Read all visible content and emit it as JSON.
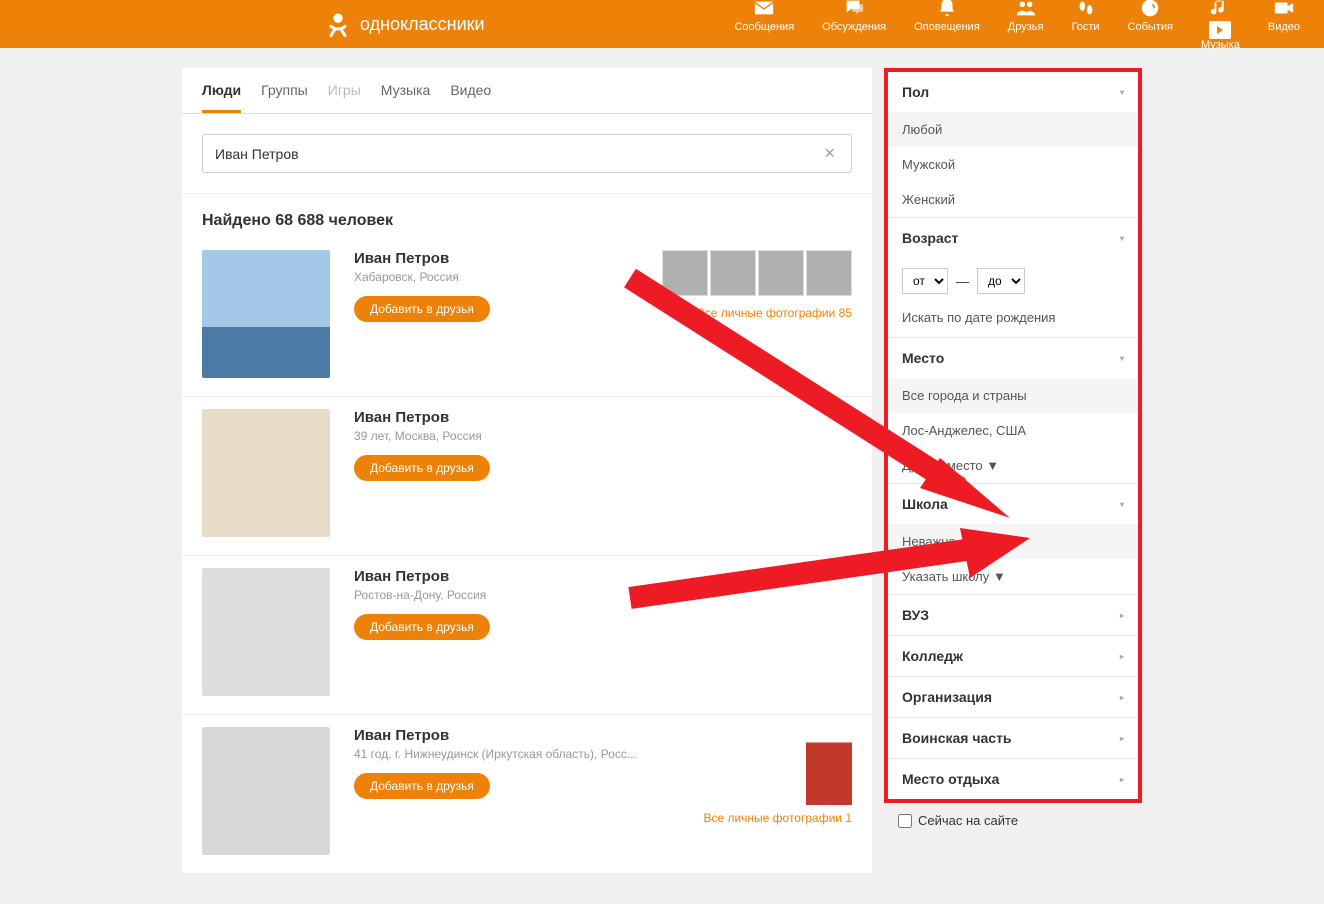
{
  "brand": "одноклассники",
  "nav": {
    "messages": "Сообщения",
    "discussions": "Обсуждения",
    "notifications": "Оповещения",
    "friends": "Друзья",
    "guests": "Гости",
    "events": "События",
    "music": "Музыка",
    "video": "Видео"
  },
  "tabs": {
    "people": "Люди",
    "groups": "Группы",
    "games": "Игры",
    "music": "Музыка",
    "video": "Видео"
  },
  "search": {
    "value": "Иван Петров"
  },
  "results_heading": "Найдено 68 688 человек",
  "add_friend_label": "Добавить в друзья",
  "results": [
    {
      "name": "Иван Петров",
      "location": "Хабаровск, Россия",
      "photos_link": "Все личные фотографии 85",
      "has_thumbs": true,
      "thumb_count": 4
    },
    {
      "name": "Иван Петров",
      "location": "39 лет, Москва, Россия"
    },
    {
      "name": "Иван Петров",
      "location": "Ростов-на-Дону, Россия"
    },
    {
      "name": "Иван Петров",
      "location": "41 год, г. Нижнеудинск (Иркутская область), Росс...",
      "photos_link": "Все личные фотографии 1",
      "has_single_photo": true
    }
  ],
  "filters": {
    "gender": {
      "title": "Пол",
      "options": [
        "Любой",
        "Мужской",
        "Женский"
      ],
      "selected": "Любой"
    },
    "age": {
      "title": "Возраст",
      "from": "от",
      "to": "до",
      "dob_link": "Искать по дате рождения"
    },
    "place": {
      "title": "Место",
      "options": [
        "Все города и страны",
        "Лос-Анджелес, США",
        "Другое место ▼"
      ],
      "selected": "Все города и страны"
    },
    "school": {
      "title": "Школа",
      "options": [
        "Неважно",
        "Указать школу ▼"
      ],
      "selected": "Неважно"
    },
    "university": "ВУЗ",
    "college": "Колледж",
    "org": "Организация",
    "military": "Воинская часть",
    "vacation": "Место отдыха"
  },
  "online_now": "Сейчас на сайте",
  "age_dash": "—"
}
